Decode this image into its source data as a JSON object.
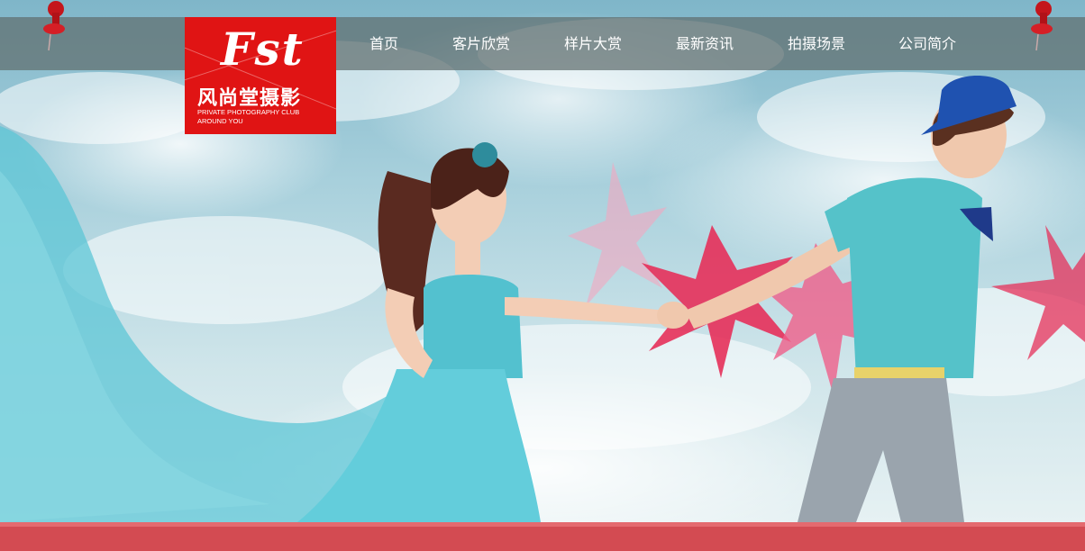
{
  "logo": {
    "mark": "Fst",
    "name_cn": "风尚堂摄影",
    "tagline_line1": "PRIVATE PHOTOGRAPHY CLUB",
    "tagline_line2": "AROUND YOU",
    "color": "#e01414"
  },
  "nav": {
    "items": [
      {
        "label": "首页"
      },
      {
        "label": "客片欣赏"
      },
      {
        "label": "样片大赏"
      },
      {
        "label": "最新资讯"
      },
      {
        "label": "拍摄场景"
      },
      {
        "label": "公司简介"
      }
    ]
  },
  "colors": {
    "accent": "#e01414",
    "bottom_bar": "#d34b52",
    "dress": "#5cc6d6",
    "shirt": "#55c2c9",
    "starfish": "#e5305a"
  },
  "icons": {
    "pin_left": "push-pin-icon",
    "pin_right": "push-pin-icon"
  }
}
